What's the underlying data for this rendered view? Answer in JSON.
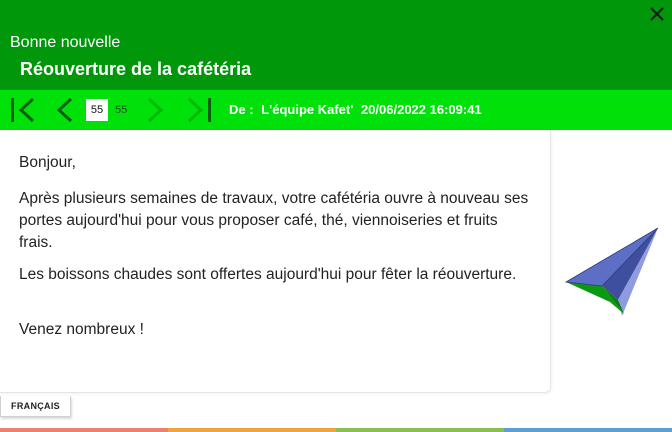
{
  "header": {
    "subtitle": "Bonne nouvelle",
    "title": "Réouverture de la cafétéria",
    "close_icon": "close-icon"
  },
  "toolbar": {
    "icons": [
      "first-page-icon",
      "prev-page-icon",
      "next-page-icon",
      "last-page-icon"
    ],
    "current_page": "55",
    "total_pages": "55",
    "from_label": "De :",
    "sender": "L'équipe Kafet'",
    "datetime": "20/06/2022 16:09:41"
  },
  "message": {
    "greeting": "Bonjour,",
    "paragraph1": "Après plusieurs semaines de travaux, votre cafétéria ouvre à nouveau ses portes aujourd'hui pour vous proposer café, thé, viennoiseries et fruits frais.",
    "paragraph2": "Les boissons chaudes sont offertes aujourd'hui pour fêter la réouverture.",
    "closing": "Venez nombreux !"
  },
  "language_tab": "FRANÇAIS",
  "colors": {
    "header_green": "#00970a",
    "toolbar_green": "#00e009",
    "strip": [
      "#e8836f",
      "#f0a33c",
      "#8cbf50",
      "#5a9fd4"
    ]
  }
}
